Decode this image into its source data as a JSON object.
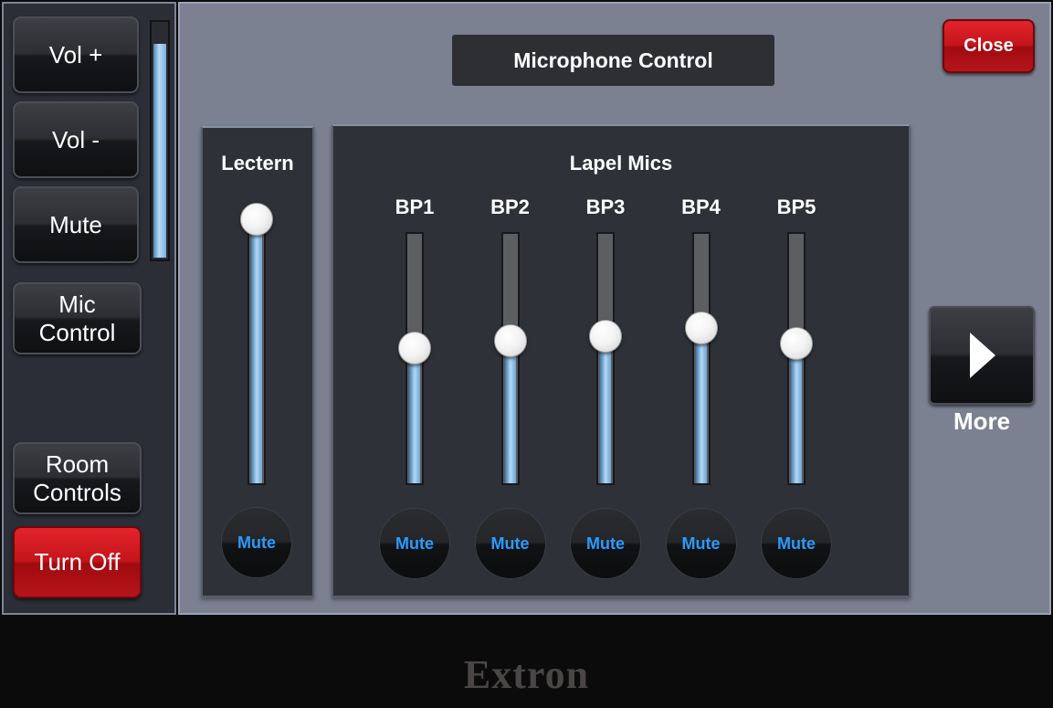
{
  "sidebar": {
    "vol_up_label": "Vol +",
    "vol_down_label": "Vol -",
    "mute_label": "Mute",
    "mic_control_label": "Mic Control",
    "room_controls_label": "Room Controls",
    "turn_off_label": "Turn Off",
    "volume_level": 0.9
  },
  "header": {
    "title": "Microphone Control",
    "close_label": "Close"
  },
  "lectern": {
    "label": "Lectern",
    "level": 1.0,
    "mute_label": "Mute"
  },
  "lapel": {
    "label": "Lapel Mics",
    "channels": [
      {
        "label": "BP1",
        "level": 0.54,
        "mute_label": "Mute"
      },
      {
        "label": "BP2",
        "level": 0.57,
        "mute_label": "Mute"
      },
      {
        "label": "BP3",
        "level": 0.59,
        "mute_label": "Mute"
      },
      {
        "label": "BP4",
        "level": 0.62,
        "mute_label": "Mute"
      },
      {
        "label": "BP5",
        "level": 0.56,
        "mute_label": "Mute"
      }
    ]
  },
  "more": {
    "label": "More",
    "icon": "chevron-right-icon"
  },
  "footer": {
    "brand": "Extron"
  },
  "colors": {
    "accent_red": "#c3151b",
    "fader_blue": "#7ab0da",
    "mute_text": "#2a9bff"
  }
}
